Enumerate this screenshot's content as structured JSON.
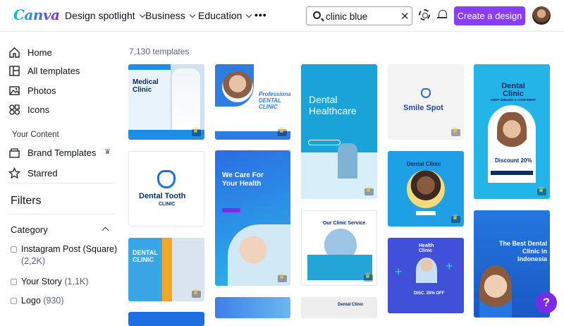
{
  "app": {
    "logo": "Canva"
  },
  "nav": {
    "items": [
      {
        "label": "Design spotlight"
      },
      {
        "label": "Business"
      },
      {
        "label": "Education"
      }
    ],
    "more": "•••"
  },
  "search": {
    "value": "clinic blue",
    "clear": "✕"
  },
  "header": {
    "create_label": "Create a design"
  },
  "sidebar": {
    "items": [
      {
        "label": "Home",
        "icon": "home-icon"
      },
      {
        "label": "All templates",
        "icon": "templates-icon"
      },
      {
        "label": "Photos",
        "icon": "photos-icon"
      },
      {
        "label": "Icons",
        "icon": "icons-icon"
      }
    ],
    "your_content_label": "Your Content",
    "content_items": [
      {
        "label": "Brand Templates",
        "icon": "brand-templates-icon"
      },
      {
        "label": "Starred",
        "icon": "star-icon"
      }
    ],
    "filters_title": "Filters",
    "category_title": "Category",
    "categories": [
      {
        "label": "Instagram Post (Square)",
        "count": "(2,2K)"
      },
      {
        "label": "Your Story",
        "count": "(1,1K)"
      },
      {
        "label": "Logo",
        "count": "(930)"
      }
    ]
  },
  "results": {
    "count_label": "7,130 templates"
  },
  "templates": [
    {
      "title": "Medical Clinic",
      "bg": "#e9f3fb"
    },
    {
      "title": "Professional DENTAL CLINIC",
      "bg": "#2f7de1"
    },
    {
      "title": "Dental Healthcare",
      "bg": "#1aa3d8"
    },
    {
      "title": "Smile Spot",
      "bg": "#f4f4f4"
    },
    {
      "title": "Dental Clinic",
      "subtitle": "KEEP SMILING & CONFIDENT",
      "bg": "#23b4e8"
    },
    {
      "title": "Dental Tooth",
      "subtitle": "CLINIC",
      "bg": "#ffffff"
    },
    {
      "title": "We Care For Your Health",
      "bg": "#2a6de4"
    },
    {
      "title": "Dental Clinic",
      "bg": "#1e9fe6"
    },
    {
      "title": "DENTAL CLINIC",
      "bg": "#3aa6e6"
    },
    {
      "title": "Our Clinic Service",
      "bg": "#ffffff"
    },
    {
      "title": "Health Clinic",
      "bg": "#4050d8"
    },
    {
      "title": "The Best Dental Clinic in Indonesia",
      "bg": "#2476e0"
    },
    {
      "title": "Discount 20%",
      "bg": "#ffffff"
    },
    {
      "title": "DISC. 20% OFF",
      "bg": "#4050d8"
    },
    {
      "title": "Dental Clinic",
      "bg": "#eee"
    }
  ],
  "help": {
    "label": "?"
  }
}
